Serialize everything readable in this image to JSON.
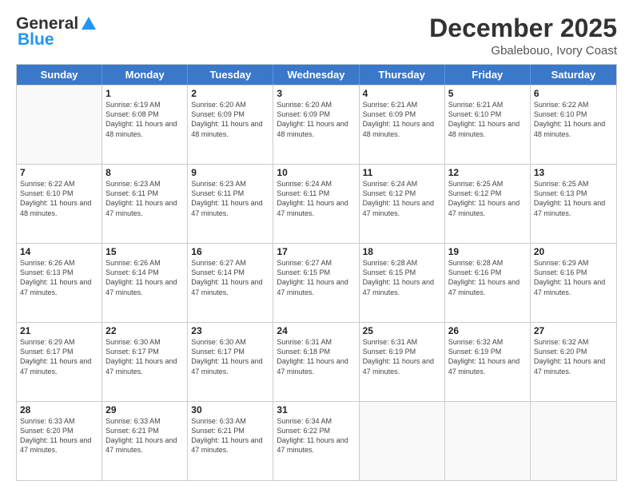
{
  "header": {
    "logo_general": "General",
    "logo_blue": "Blue",
    "month_title": "December 2025",
    "location": "Gbalebouo, Ivory Coast"
  },
  "weekdays": [
    "Sunday",
    "Monday",
    "Tuesday",
    "Wednesday",
    "Thursday",
    "Friday",
    "Saturday"
  ],
  "rows": [
    [
      {
        "day": "",
        "empty": true
      },
      {
        "day": "1",
        "sunrise": "6:19 AM",
        "sunset": "6:08 PM",
        "daylight": "11 hours and 48 minutes."
      },
      {
        "day": "2",
        "sunrise": "6:20 AM",
        "sunset": "6:09 PM",
        "daylight": "11 hours and 48 minutes."
      },
      {
        "day": "3",
        "sunrise": "6:20 AM",
        "sunset": "6:09 PM",
        "daylight": "11 hours and 48 minutes."
      },
      {
        "day": "4",
        "sunrise": "6:21 AM",
        "sunset": "6:09 PM",
        "daylight": "11 hours and 48 minutes."
      },
      {
        "day": "5",
        "sunrise": "6:21 AM",
        "sunset": "6:10 PM",
        "daylight": "11 hours and 48 minutes."
      },
      {
        "day": "6",
        "sunrise": "6:22 AM",
        "sunset": "6:10 PM",
        "daylight": "11 hours and 48 minutes."
      }
    ],
    [
      {
        "day": "7",
        "sunrise": "6:22 AM",
        "sunset": "6:10 PM",
        "daylight": "11 hours and 48 minutes."
      },
      {
        "day": "8",
        "sunrise": "6:23 AM",
        "sunset": "6:11 PM",
        "daylight": "11 hours and 47 minutes."
      },
      {
        "day": "9",
        "sunrise": "6:23 AM",
        "sunset": "6:11 PM",
        "daylight": "11 hours and 47 minutes."
      },
      {
        "day": "10",
        "sunrise": "6:24 AM",
        "sunset": "6:11 PM",
        "daylight": "11 hours and 47 minutes."
      },
      {
        "day": "11",
        "sunrise": "6:24 AM",
        "sunset": "6:12 PM",
        "daylight": "11 hours and 47 minutes."
      },
      {
        "day": "12",
        "sunrise": "6:25 AM",
        "sunset": "6:12 PM",
        "daylight": "11 hours and 47 minutes."
      },
      {
        "day": "13",
        "sunrise": "6:25 AM",
        "sunset": "6:13 PM",
        "daylight": "11 hours and 47 minutes."
      }
    ],
    [
      {
        "day": "14",
        "sunrise": "6:26 AM",
        "sunset": "6:13 PM",
        "daylight": "11 hours and 47 minutes."
      },
      {
        "day": "15",
        "sunrise": "6:26 AM",
        "sunset": "6:14 PM",
        "daylight": "11 hours and 47 minutes."
      },
      {
        "day": "16",
        "sunrise": "6:27 AM",
        "sunset": "6:14 PM",
        "daylight": "11 hours and 47 minutes."
      },
      {
        "day": "17",
        "sunrise": "6:27 AM",
        "sunset": "6:15 PM",
        "daylight": "11 hours and 47 minutes."
      },
      {
        "day": "18",
        "sunrise": "6:28 AM",
        "sunset": "6:15 PM",
        "daylight": "11 hours and 47 minutes."
      },
      {
        "day": "19",
        "sunrise": "6:28 AM",
        "sunset": "6:16 PM",
        "daylight": "11 hours and 47 minutes."
      },
      {
        "day": "20",
        "sunrise": "6:29 AM",
        "sunset": "6:16 PM",
        "daylight": "11 hours and 47 minutes."
      }
    ],
    [
      {
        "day": "21",
        "sunrise": "6:29 AM",
        "sunset": "6:17 PM",
        "daylight": "11 hours and 47 minutes."
      },
      {
        "day": "22",
        "sunrise": "6:30 AM",
        "sunset": "6:17 PM",
        "daylight": "11 hours and 47 minutes."
      },
      {
        "day": "23",
        "sunrise": "6:30 AM",
        "sunset": "6:17 PM",
        "daylight": "11 hours and 47 minutes."
      },
      {
        "day": "24",
        "sunrise": "6:31 AM",
        "sunset": "6:18 PM",
        "daylight": "11 hours and 47 minutes."
      },
      {
        "day": "25",
        "sunrise": "6:31 AM",
        "sunset": "6:19 PM",
        "daylight": "11 hours and 47 minutes."
      },
      {
        "day": "26",
        "sunrise": "6:32 AM",
        "sunset": "6:19 PM",
        "daylight": "11 hours and 47 minutes."
      },
      {
        "day": "27",
        "sunrise": "6:32 AM",
        "sunset": "6:20 PM",
        "daylight": "11 hours and 47 minutes."
      }
    ],
    [
      {
        "day": "28",
        "sunrise": "6:33 AM",
        "sunset": "6:20 PM",
        "daylight": "11 hours and 47 minutes."
      },
      {
        "day": "29",
        "sunrise": "6:33 AM",
        "sunset": "6:21 PM",
        "daylight": "11 hours and 47 minutes."
      },
      {
        "day": "30",
        "sunrise": "6:33 AM",
        "sunset": "6:21 PM",
        "daylight": "11 hours and 47 minutes."
      },
      {
        "day": "31",
        "sunrise": "6:34 AM",
        "sunset": "6:22 PM",
        "daylight": "11 hours and 47 minutes."
      },
      {
        "day": "",
        "empty": true
      },
      {
        "day": "",
        "empty": true
      },
      {
        "day": "",
        "empty": true
      }
    ]
  ]
}
